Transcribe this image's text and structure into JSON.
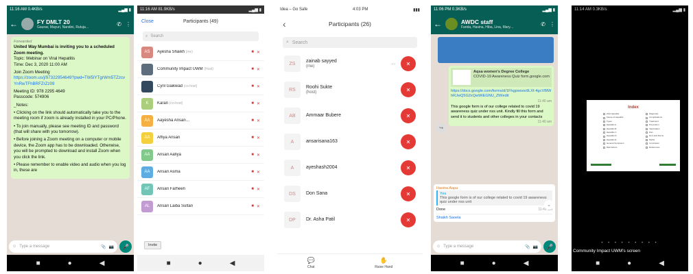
{
  "p1": {
    "status_time": "11:16 AM 0.4KB/s",
    "title": "FY DMLT 20",
    "subtitle": "Gaurav, Mayuri, Nandini, Rutuja…",
    "forwarded": "Forwarded",
    "bold_line": "United Way Mumbai is inviting you to a scheduled Zoom meeting.",
    "topic": "Topic: Webinar on Viral Hepatitis",
    "time": "Time: Dec 3, 2020 11:00 AM",
    "join": "Join Zoom Meeting",
    "link": "https://zoom.us/j/97322954649?pwd=TW5lYTgrWm5TZzcvYnRwTFhBRFZrZz09",
    "meeting_id": "Meeting ID: 978 2295 4649",
    "passcode": "Passcode: 574906",
    "notes_title": "_Notes:",
    "notes": [
      "• Clicking on the link should automatically take you to the meeting room if zoom is already installed in your PC/Phone.",
      "• To join manually, please see meeting ID and password (that will share with you tomorrow).",
      "• Before joining a Zoom meeting on a computer or mobile device, the Zoom app has to be downloaded. Otherwise, you will be prompted to download and install Zoom when you click the link.",
      "• Please remember to enable video and audio when you log in, these are"
    ],
    "input_placeholder": "Type a message"
  },
  "p2": {
    "status_time": "11:16 AM 81.9KB/s",
    "close": "Close",
    "title": "Participants (49)",
    "search_placeholder": "Search",
    "invite": "Invite",
    "participants": [
      {
        "initials": "AS",
        "name": "Ayesha Shaikh",
        "tag": "(me)",
        "color": "#d98880"
      },
      {
        "initials": "",
        "name": "Community Impact UWM",
        "tag": "(Host)",
        "color": "#5d6d7e"
      },
      {
        "initials": "",
        "name": "Cyril Gaikwad",
        "tag": "(co-host)",
        "color": "#34495e"
      },
      {
        "initials": "K",
        "name": "Karan",
        "tag": "(co-host)",
        "color": "#a9cf7c"
      },
      {
        "initials": "AA",
        "name": "Aayesha Ansari…",
        "tag": "",
        "color": "#f5b041"
      },
      {
        "initials": "AA",
        "name": "Affiya Ansari",
        "tag": "",
        "color": "#f4d03f"
      },
      {
        "initials": "AA",
        "name": "Ansari Aafiya",
        "tag": "",
        "color": "#82c98c"
      },
      {
        "initials": "AA",
        "name": "Ansari Asma",
        "tag": "",
        "color": "#5dade2"
      },
      {
        "initials": "AF",
        "name": "Ansari Farheen",
        "tag": "",
        "color": "#73c6b6"
      },
      {
        "initials": "AL",
        "name": "Ansari Laiba Sultan",
        "tag": "",
        "color": "#c39bd3"
      }
    ]
  },
  "p3": {
    "status_left": "Idea – Go Safe",
    "status_time": "4:03 PM",
    "title": "Participants (26)",
    "search_placeholder": "Search",
    "participants": [
      {
        "initials": "ZS",
        "name": "zainab sayyed",
        "tag": "(me)"
      },
      {
        "initials": "RS",
        "name": "Roohi Sukte",
        "tag": "(host)"
      },
      {
        "initials": "AB",
        "name": "Ammaar Bubere",
        "tag": ""
      },
      {
        "initials": "A",
        "name": "ansarisana163",
        "tag": ""
      },
      {
        "initials": "A",
        "name": "ayeshash2004",
        "tag": ""
      },
      {
        "initials": "DS",
        "name": "Don Sana",
        "tag": ""
      },
      {
        "initials": "DP",
        "name": "Dr. Asha Patil",
        "tag": ""
      }
    ],
    "bottom_chat": "Chat",
    "bottom_raise": "Raise Hand"
  },
  "p4": {
    "status_time": "11:06 PM 0.3KB/s",
    "title": "AWDC staff",
    "subtitle": "Farida, Hasina, Hiba, Lina, Mary…",
    "preview_title": "Aqsa women's Degree College",
    "preview_sub": "COVID-19 Awareness Quiz form.google.com",
    "link": "https://docs.google.com/forms/d/1Fhgpwooo9LXf-4gcVBlWhRJwQ5G2xQwWiEGNU_ZM/edit",
    "link_time": "11:40 am",
    "message": "This google form is of our college related to covid 19 awareness quiz under nss unit. Kindly fill this form and send it to students and other colleges in your contacts",
    "msg_time": "11:40 am",
    "reply_author": "Yes",
    "reply_quote": "This google form is of our college related to covid 19 awareness quiz under nss unit",
    "reply_top": "Hasina Aapa",
    "reply_text": "Done",
    "reply_time": "11:41 am",
    "sender": "Shaikh Saoela",
    "input_placeholder": "Type a message"
  },
  "p5": {
    "status_time": "11:14 AM 0.3KB/s",
    "slide_title": "Index",
    "col1": [
      "Viral Hepatitis",
      "Cause of Hepatitis",
      "Types",
      "Hepatitis A",
      "Hepatitis B",
      "Hepatitis C",
      "Hepatitis D",
      "Hepatitis E",
      "General Symptoms",
      "Risk factors"
    ],
    "col2": [
      "Diagnosis",
      "Complications",
      "Treatment",
      "Prevention",
      "Vaccination",
      "Diet",
      "Do's and Don'ts",
      "Myths",
      "Conclusion",
      "References"
    ],
    "dots": "• • • • • • • • •",
    "label": "Community Impact UWM's screen"
  },
  "nav": {
    "square": "■",
    "circle": "●",
    "back": "◀"
  },
  "icons": {
    "mic": "🎤",
    "video": "▶",
    "mic_muted": "✕"
  },
  "colors": {
    "whatsapp": "#075e54",
    "bubble": "#dcf8c6",
    "zoom_red": "#e53935",
    "link": "#1a73e8"
  }
}
